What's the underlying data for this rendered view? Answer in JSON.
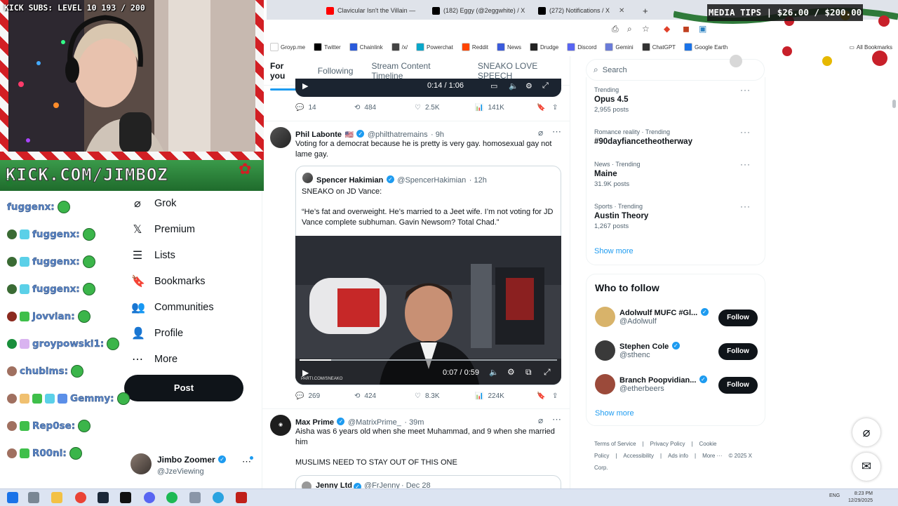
{
  "overlay": {
    "kick_subs": "KICK SUBS: LEVEL 10 193 / 200",
    "media_tips": "MEDIA TIPS | $26.00 / $200.00",
    "stream_url": "KICK.COM/JIMBOZ"
  },
  "browser": {
    "tabs": [
      {
        "label": "Clavicular Isn't the Villain —",
        "favicon_color": "#ff0000"
      },
      {
        "label": "(182) Eggy (@2eggwhite) / X",
        "favicon_color": "#000000"
      },
      {
        "label": "(272) Notifications / X",
        "favicon_color": "#000000"
      }
    ],
    "new_tab_icon": "plus-icon",
    "bookmarks": [
      {
        "label": "Groyp.me",
        "color": "#ffffff"
      },
      {
        "label": "Twitter",
        "color": "#000000"
      },
      {
        "label": "Chainlink",
        "color": "#2a5ada"
      },
      {
        "label": "/x/",
        "color": "#444444"
      },
      {
        "label": "Powerchat",
        "color": "#0aa7c9"
      },
      {
        "label": "Reddit",
        "color": "#ff4500"
      },
      {
        "label": "News",
        "color": "#3b5bdb"
      },
      {
        "label": "Drudge",
        "color": "#222222"
      },
      {
        "label": "Discord",
        "color": "#5865f2"
      },
      {
        "label": "Gemini",
        "color": "#6a7bd8"
      },
      {
        "label": "ChatGPT",
        "color": "#333333"
      },
      {
        "label": "Google Earth",
        "color": "#1a73e8"
      }
    ],
    "all_bookmarks": "All Bookmarks"
  },
  "x": {
    "home_tabs": [
      "For you",
      "Following",
      "Stream Content Timeline",
      "SNEAKO LOVE SPEECH"
    ],
    "top_video": {
      "time": "0:14 / 1:06"
    },
    "top_actions": {
      "replies": "14",
      "reposts": "484",
      "likes": "2.5K",
      "views": "141K"
    },
    "tweet1": {
      "name": "Phil Labonte",
      "flag": "🇺🇸",
      "handle": "@philthatremains",
      "time": "· 9h",
      "text": "Voting for a democrat because he is pretty is very gay. homosexual gay not lame gay.",
      "quote": {
        "name": "Spencer Hakimian",
        "handle": "@SpencerHakimian",
        "time": "· 12h",
        "line1": "SNEAKO on JD Vance:",
        "line2": "“He’s fat and overweight. He’s married to a Jeet wife. I’m not voting for JD Vance complete subhuman. Gavin Newsom? Total Chad.”",
        "video_time": "0:07 / 0:59",
        "watermark": "PARTI.COM/SNEAKO"
      },
      "actions": {
        "replies": "269",
        "reposts": "424",
        "likes": "8.3K",
        "views": "224K"
      }
    },
    "tweet2": {
      "name": "Max Prime",
      "handle": "@MatrixPrime_",
      "time": "· 39m",
      "text": "Aisha was 6 years old when she meet Muhammad,  and 9 when she married him",
      "text2": "MUSLIMS NEED TO STAY OUT OF THIS ONE"
    },
    "tweet3_partial": {
      "name": "Jenny Ltd",
      "handle": "@FrJenny",
      "time": "· Dec 28"
    },
    "nav": [
      {
        "label": "Grok",
        "icon": "grok-icon",
        "glyph": "⌀"
      },
      {
        "label": "Premium",
        "icon": "x-logo-icon",
        "glyph": "𝕏"
      },
      {
        "label": "Lists",
        "icon": "lists-icon",
        "glyph": "☰"
      },
      {
        "label": "Bookmarks",
        "icon": "bookmark-icon",
        "glyph": "🔖"
      },
      {
        "label": "Communities",
        "icon": "communities-icon",
        "glyph": "👥"
      },
      {
        "label": "Profile",
        "icon": "profile-icon",
        "glyph": "👤"
      },
      {
        "label": "More",
        "icon": "more-icon",
        "glyph": "⋯"
      }
    ],
    "post_button": "Post",
    "account": {
      "name": "Jimbo Zoomer",
      "handle": "@JzeViewing"
    },
    "search_placeholder": "Search",
    "trends": [
      {
        "category": "Trending",
        "title": "Opus 4.5",
        "posts": "2,955 posts"
      },
      {
        "category": "Romance reality · Trending",
        "title": "#90dayfiancetheotherway",
        "posts": ""
      },
      {
        "category": "News · Trending",
        "title": "Maine",
        "posts": "31.9K posts"
      },
      {
        "category": "Sports · Trending",
        "title": "Austin Theory",
        "posts": "1,267 posts"
      }
    ],
    "show_more": "Show more",
    "who_to_follow": {
      "title": "Who to follow",
      "users": [
        {
          "name": "Adolwulf MUFC #Gl...",
          "handle": "@Adolwulf"
        },
        {
          "name": "Stephen Cole",
          "handle": "@sthenc"
        },
        {
          "name": "Branch Poopvidian...",
          "handle": "@etherbeers"
        }
      ],
      "follow_label": "Follow",
      "show_more": "Show more"
    },
    "footer": [
      "Terms of Service",
      "|",
      "Privacy Policy",
      "|",
      "Cookie Policy",
      "|",
      "Accessibility",
      "|",
      "Ads info",
      "|",
      "More ···",
      "© 2025 X Corp."
    ]
  },
  "chat": [
    {
      "user": "fuggenx:",
      "badges": []
    },
    {
      "user": "fuggenx:",
      "badges": [
        "#3a6b34",
        "#5bd0e8"
      ]
    },
    {
      "user": "fuggenx:",
      "badges": [
        "#3a6b34",
        "#5bd0e8"
      ]
    },
    {
      "user": "fuggenx:",
      "badges": [
        "#3a6b34",
        "#5bd0e8"
      ]
    },
    {
      "user": "Jovvian:",
      "badges": [
        "#8b2a1f",
        "#3fbf4a"
      ]
    },
    {
      "user": "groypowski1:",
      "badges": [
        "#1a8f3c",
        "#d9b3f0"
      ]
    },
    {
      "user": "chubims:",
      "badges": [
        "#a07060"
      ]
    },
    {
      "user": "Gemmy:",
      "badges": [
        "#a07060",
        "#f0c070",
        "#3fbf4a",
        "#5bd0e8",
        "#5b8fe8"
      ]
    },
    {
      "user": "Rep0se:",
      "badges": [
        "#a07060",
        "#3fbf4a"
      ]
    },
    {
      "user": "R00ni:",
      "badges": [
        "#a07060",
        "#3fbf4a"
      ]
    }
  ],
  "taskbar": {
    "lang": "ENG",
    "time": "8:23 PM",
    "date": "12/29/2025"
  }
}
